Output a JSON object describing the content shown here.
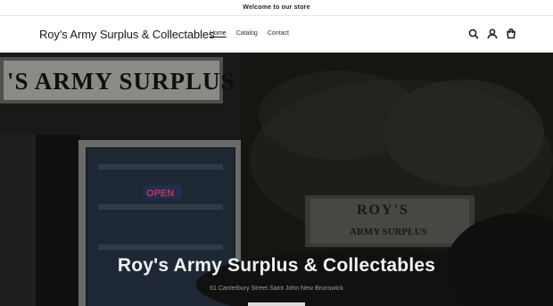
{
  "announcement": {
    "text": "Welcome to our store"
  },
  "header": {
    "brand": "Roy's Army Surplus & Collectables",
    "nav": [
      {
        "label": "Home",
        "active": true
      },
      {
        "label": "Catalog",
        "active": false
      },
      {
        "label": "Contact",
        "active": false
      }
    ],
    "icons": [
      "search-icon",
      "account-icon",
      "cart-icon"
    ]
  },
  "hero": {
    "title": "Roy's Army Surplus & Collectables",
    "subtitle": "61 Canterbury Street Saint John New Brunswick",
    "storefront_sign": "'S ARMY SURPLUS",
    "open_sign": "OPEN",
    "roadside_sign_top": "ROY'S",
    "roadside_sign_bottom": "ARMY SURPLUS"
  },
  "colors": {
    "text": "#121212",
    "hero_text": "#f2f2f2",
    "hero_subtext": "#9a9a9a",
    "border": "#e6e6e6"
  }
}
